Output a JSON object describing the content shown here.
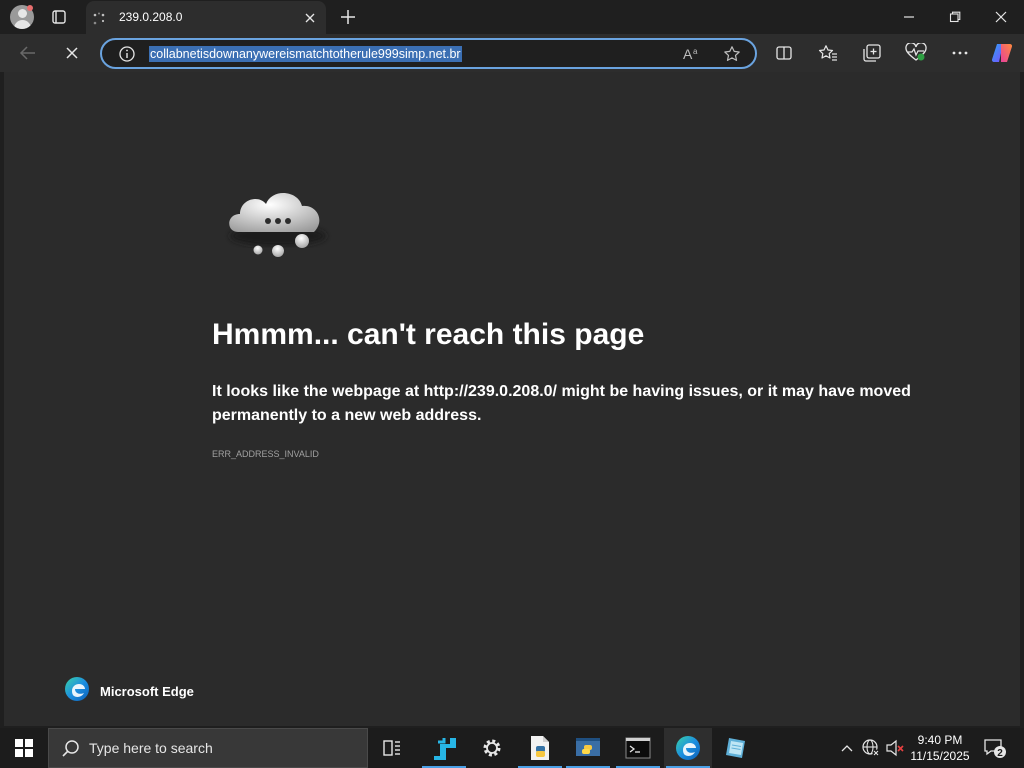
{
  "browser": {
    "tab_title": "239.0.208.0",
    "address_url": "collabnetisdownanywereismatchtotherule999simp.net.br",
    "read_aloud_label": "A",
    "read_aloud_sup": "a"
  },
  "error_page": {
    "headline": "Hmmm... can't reach this page",
    "desc_before": "It looks like the webpage at ",
    "desc_url": "http://239.0.208.0/",
    "desc_after": " might be having issues, or it may have moved permanently to a new web address.",
    "error_code": "ERR_ADDRESS_INVALID",
    "brand_label": "Microsoft Edge"
  },
  "taskbar": {
    "search_placeholder": "Type here to search",
    "time": "9:40 PM",
    "date": "11/15/2025",
    "notification_count": "2"
  },
  "colors": {
    "accent": "#4aa0e6",
    "address_focus": "#6aa3df",
    "selection": "#3b6fb3"
  }
}
